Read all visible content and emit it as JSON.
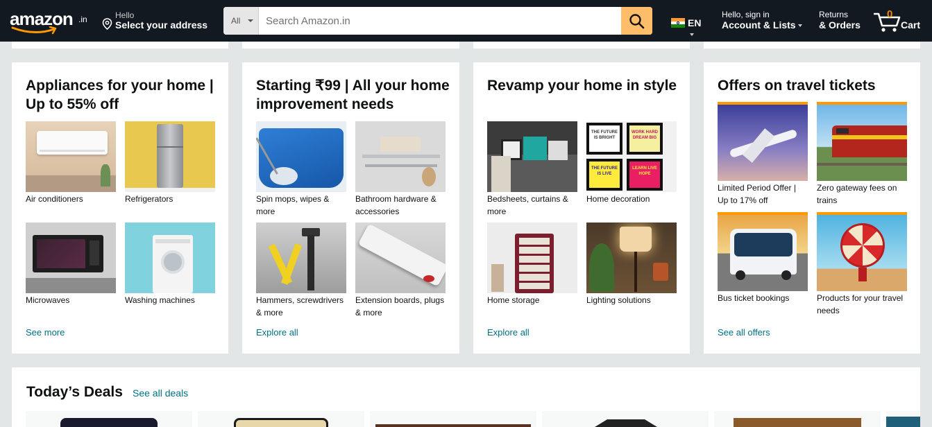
{
  "nav": {
    "logo_text": "amazon",
    "logo_tld": ".in",
    "address_line1": "Hello",
    "address_line2": "Select your address",
    "search_category": "All",
    "search_placeholder": "Search Amazon.in",
    "language": "EN",
    "account_line1": "Hello, sign in",
    "account_line2": "Account & Lists",
    "orders_line1": "Returns",
    "orders_line2": "& Orders",
    "cart_count": "0",
    "cart_label": "Cart"
  },
  "cards": [
    {
      "title": "Appliances for your home | Up to 55% off",
      "link": "See more",
      "items": [
        "Air conditioners",
        "Refrigerators",
        "Microwaves",
        "Washing machines"
      ]
    },
    {
      "title": "Starting ₹99 | All your home improvement needs",
      "link": "Explore all",
      "items": [
        "Spin mops, wipes & more",
        "Bathroom hardware & accessories",
        "Hammers, screwdrivers & more",
        "Extension boards, plugs & more"
      ]
    },
    {
      "title": "Revamp your home in style",
      "link": "Explore all",
      "items": [
        "Bedsheets, curtains & more",
        "Home decoration",
        "Home storage",
        "Lighting solutions"
      ],
      "frame_texts": [
        "THE FUTURE IS BRIGHT",
        "WORK HARD DREAM BIG",
        "THE FUTURE IS LIVE",
        "LEARN LIVE HOPE"
      ]
    },
    {
      "title": "Offers on travel tickets",
      "link": "See all offers",
      "items": [
        "Limited Period Offer | Up to 17% off",
        "Zero gateway fees on trains",
        "Bus ticket bookings",
        "Products for your travel needs"
      ]
    }
  ],
  "deals": {
    "title": "Today’s Deals",
    "link": "See all deals"
  },
  "colors": {
    "nav_bg": "#131921",
    "page_bg": "#e3e6e6",
    "search_button": "#febd69",
    "link": "#007185",
    "accent": "#ff9900",
    "cart_count": "#f08804"
  }
}
